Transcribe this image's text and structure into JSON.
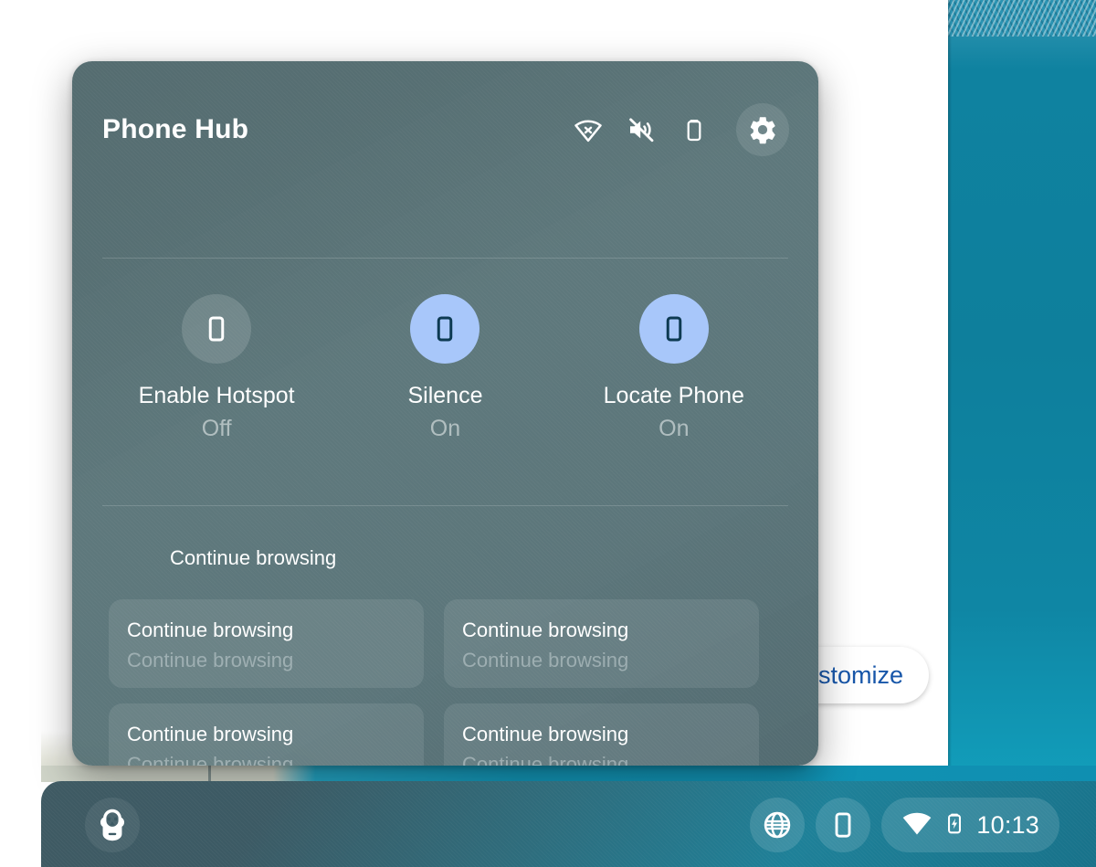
{
  "panel": {
    "title": "Phone Hub",
    "header_icons": [
      {
        "name": "signal-off-icon",
        "glyph": "signal-off"
      },
      {
        "name": "volume-mute-icon",
        "glyph": "volume-off"
      },
      {
        "name": "battery-icon",
        "glyph": "battery-empty"
      }
    ],
    "settings_button": {
      "name": "settings-gear-button",
      "glyph": "gear"
    },
    "quick_actions": [
      {
        "label": "Enable Hotspot",
        "state": "Off",
        "active": false,
        "icon": "phone-icon"
      },
      {
        "label": "Silence",
        "state": "On",
        "active": true,
        "icon": "phone-icon"
      },
      {
        "label": "Locate Phone",
        "state": "On",
        "active": true,
        "icon": "phone-icon"
      }
    ],
    "continue_browsing": {
      "heading": "Continue browsing",
      "cards": [
        {
          "title": "Continue browsing",
          "subtitle": "Continue browsing"
        },
        {
          "title": "Continue browsing",
          "subtitle": "Continue browsing"
        },
        {
          "title": "Continue browsing",
          "subtitle": "Continue browsing"
        },
        {
          "title": "Continue browsing",
          "subtitle": "Continue browsing"
        }
      ]
    }
  },
  "desktop": {
    "customize_button_label": "stomize"
  },
  "shelf": {
    "launcher": {
      "name": "launcher-button",
      "icon": "penguin-icon"
    },
    "apps": [
      {
        "name": "browser-button",
        "icon": "globe-icon"
      },
      {
        "name": "phone-hub-button",
        "icon": "phone-icon"
      }
    ],
    "status": {
      "wifi_icon": "wifi-icon",
      "battery_icon": "battery-charging-icon",
      "time": "10:13"
    }
  },
  "colors": {
    "panel_bg": "#4c666a",
    "active_accent": "#a8c7fa",
    "active_icon": "#0d3a52",
    "text_primary": "#ffffff",
    "text_secondary": "#9fb0b3",
    "shelf_bg": "#35606d",
    "wallpaper_teal": "#0f82a0",
    "customize_text": "#1756a9"
  }
}
